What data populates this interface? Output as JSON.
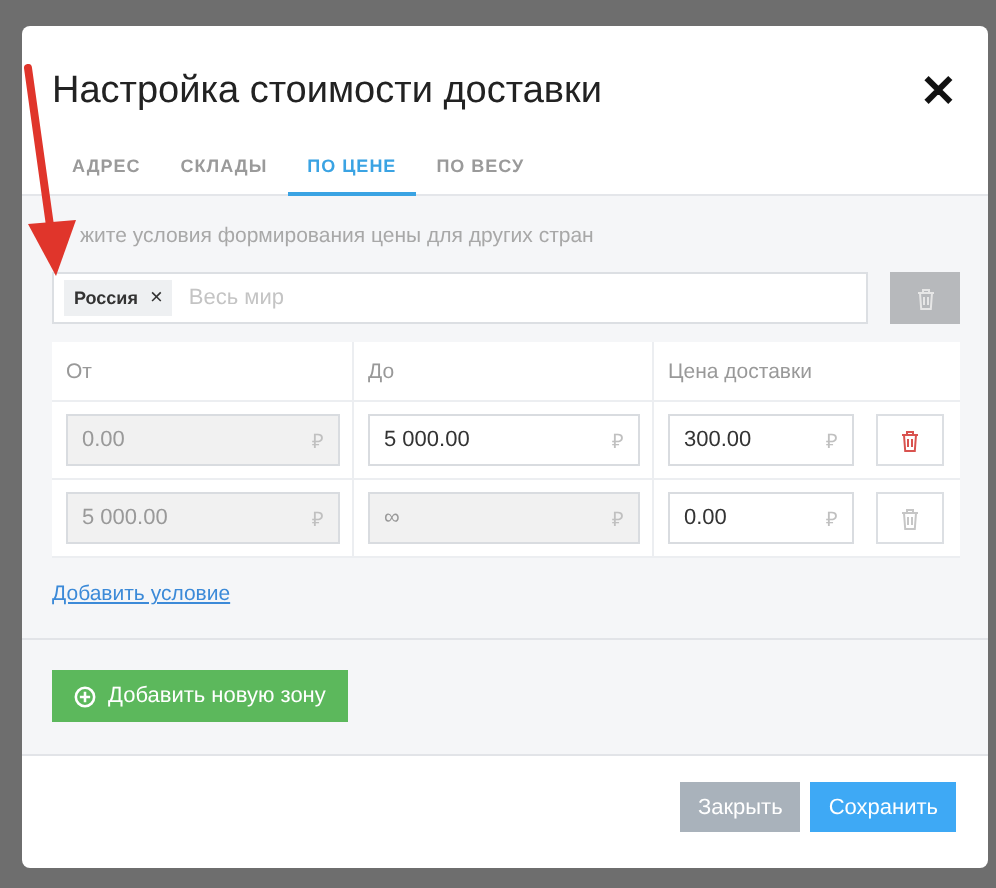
{
  "dialog": {
    "title": "Настройка стоимости доставки",
    "close": "✕"
  },
  "tabs": [
    {
      "label": "АДРЕС",
      "selected": false
    },
    {
      "label": "СКЛАДЫ",
      "selected": false
    },
    {
      "label": "ПО ЦЕНЕ",
      "selected": true
    },
    {
      "label": "ПО ВЕСУ",
      "selected": false
    }
  ],
  "hint": "жите условия формирования цены для других стран",
  "zone": {
    "tags": [
      {
        "label": "Россия",
        "remove": "×"
      }
    ],
    "placeholder": "Весь мир",
    "delete_disabled": true
  },
  "table": {
    "columns": [
      "От",
      "До",
      "Цена доставки"
    ],
    "rows": [
      {
        "cells": [
          {
            "value": "0.00",
            "currency": "₽",
            "disabled": true
          },
          {
            "value": "5 000.00",
            "currency": "₽",
            "disabled": false
          },
          {
            "value": "300.00",
            "currency": "₽",
            "disabled": false
          }
        ],
        "delete_disabled": false
      },
      {
        "cells": [
          {
            "value": "5 000.00",
            "currency": "₽",
            "disabled": true
          },
          {
            "value": "∞",
            "currency": "₽",
            "disabled": true
          },
          {
            "value": "0.00",
            "currency": "₽",
            "disabled": false
          }
        ],
        "delete_disabled": true
      }
    ]
  },
  "add_condition": "Добавить условие",
  "add_zone": "Добавить новую зону",
  "buttons": [
    {
      "label": "Закрыть",
      "kind": "secondary"
    },
    {
      "label": "Сохранить",
      "kind": "primary"
    }
  ]
}
